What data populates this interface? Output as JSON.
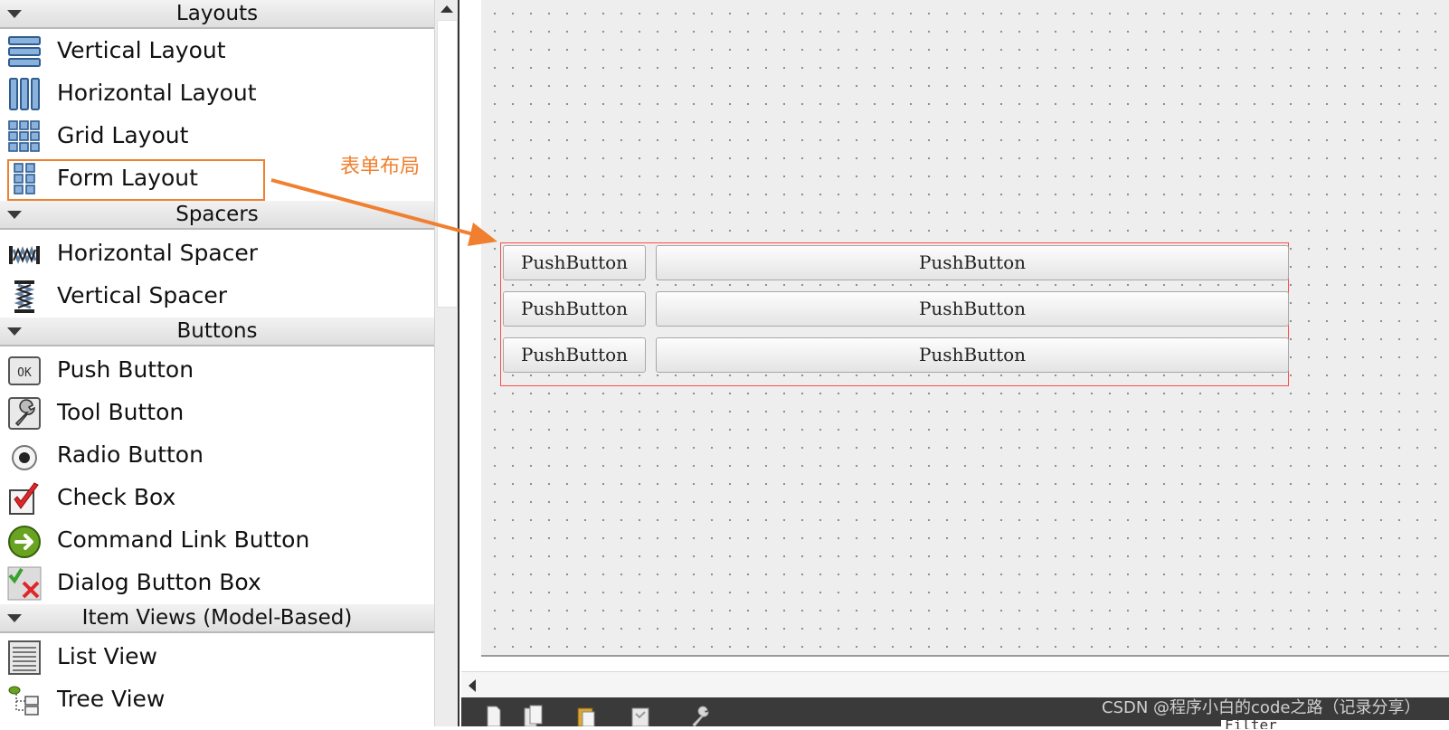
{
  "widget_box": {
    "categories": [
      {
        "title": "Layouts",
        "items": [
          {
            "label": "Vertical Layout",
            "icon": "vertical-layout-icon"
          },
          {
            "label": "Horizontal Layout",
            "icon": "horizontal-layout-icon"
          },
          {
            "label": "Grid Layout",
            "icon": "grid-layout-icon"
          },
          {
            "label": "Form Layout",
            "icon": "form-layout-icon"
          }
        ]
      },
      {
        "title": "Spacers",
        "items": [
          {
            "label": "Horizontal Spacer",
            "icon": "horizontal-spacer-icon"
          },
          {
            "label": "Vertical Spacer",
            "icon": "vertical-spacer-icon"
          }
        ]
      },
      {
        "title": "Buttons",
        "items": [
          {
            "label": "Push Button",
            "icon": "push-button-icon"
          },
          {
            "label": "Tool Button",
            "icon": "tool-button-icon"
          },
          {
            "label": "Radio Button",
            "icon": "radio-button-icon"
          },
          {
            "label": "Check Box",
            "icon": "check-box-icon"
          },
          {
            "label": "Command Link Button",
            "icon": "command-link-icon"
          },
          {
            "label": "Dialog Button Box",
            "icon": "dialog-button-box-icon"
          }
        ]
      },
      {
        "title": "Item Views (Model-Based)",
        "items": [
          {
            "label": "List View",
            "icon": "list-view-icon"
          },
          {
            "label": "Tree View",
            "icon": "tree-view-icon"
          }
        ]
      }
    ],
    "push_icon_text": "OK"
  },
  "annotation": {
    "text": "表单布局",
    "color": "#f08030"
  },
  "form": {
    "layout_border_color": "#ff4d4d",
    "rows": [
      {
        "left": "PushButton",
        "right": "PushButton"
      },
      {
        "left": "PushButton",
        "right": "PushButton"
      },
      {
        "left": "PushButton",
        "right": "PushButton"
      }
    ]
  },
  "bottom_panel": {
    "filter_text": "Filter"
  },
  "watermark": "CSDN @程序小白的code之路（记录分享）"
}
